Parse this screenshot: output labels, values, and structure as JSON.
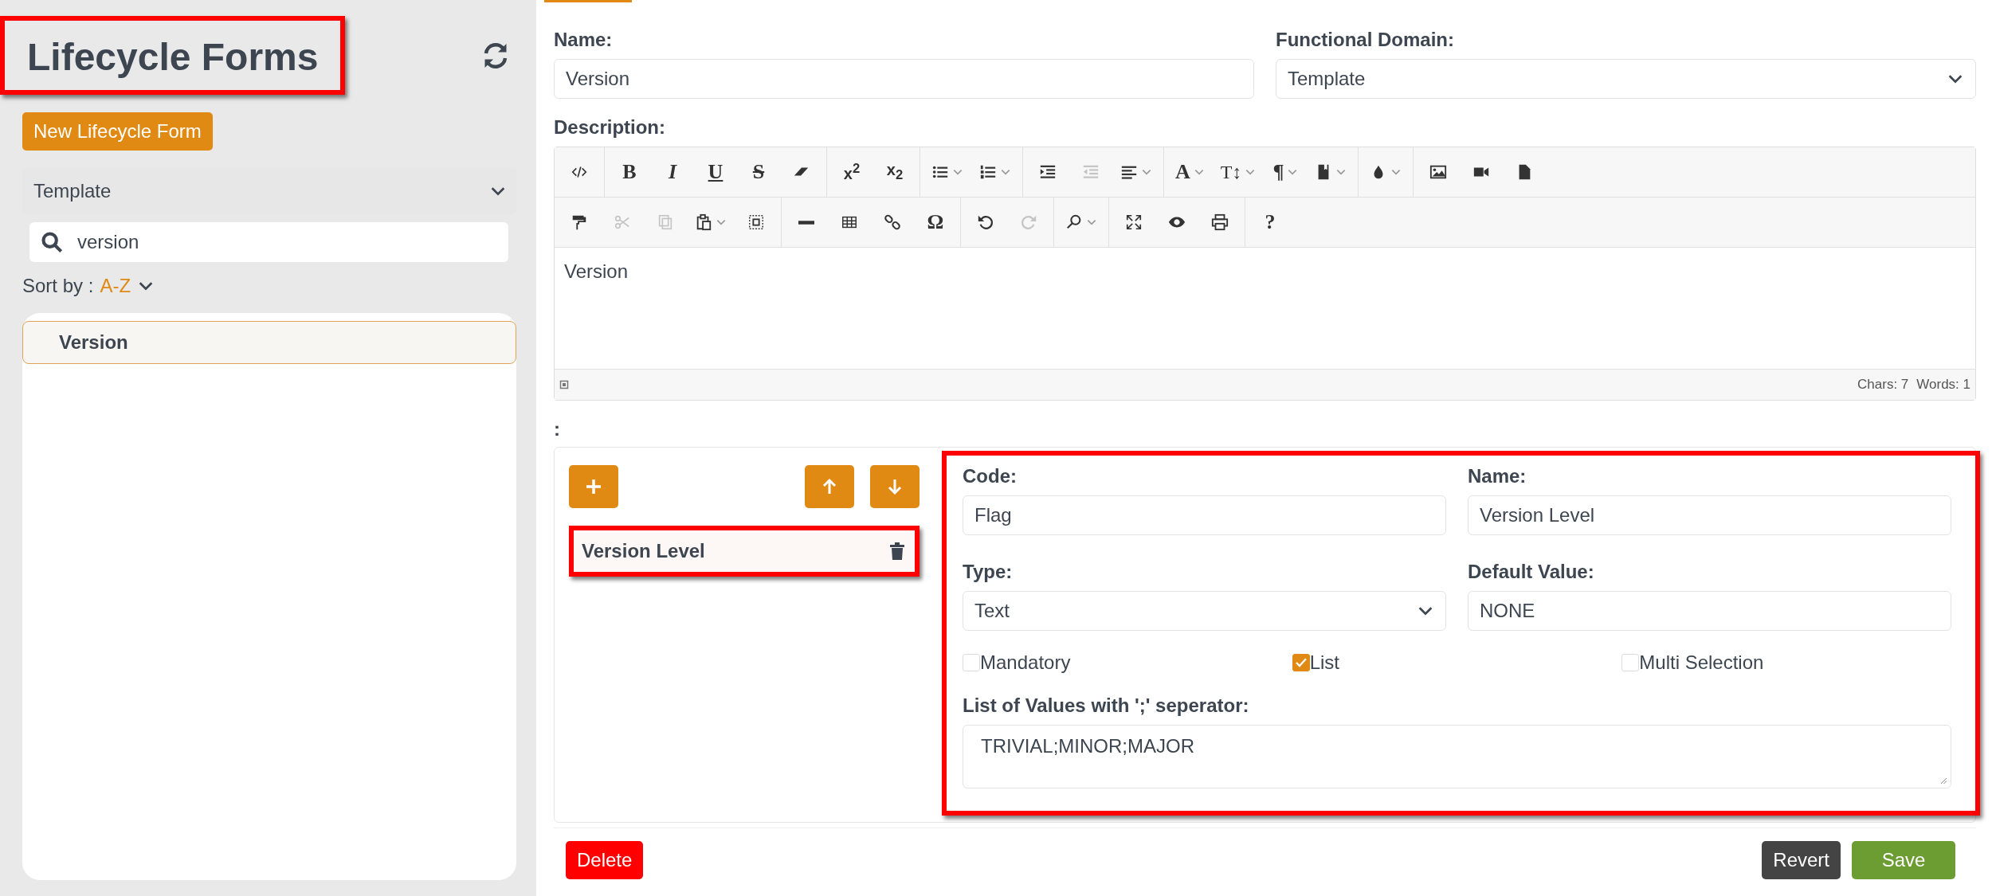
{
  "sidebar": {
    "title": "Lifecycle Forms",
    "new_button": "New Lifecycle Form",
    "domain_filter": "Template",
    "search": {
      "value": "version"
    },
    "sort": {
      "label": "Sort by :",
      "value": "A-Z"
    },
    "items": [
      {
        "label": "Version",
        "selected": true
      }
    ]
  },
  "form": {
    "name": {
      "label": "Name:",
      "value": "Version"
    },
    "domain": {
      "label": "Functional Domain:",
      "value": "Template"
    },
    "description": {
      "label": "Description:",
      "value": "Version",
      "chars": "Chars: 7",
      "words": "Words: 1"
    },
    "toolbar": [
      [
        [
          {
            "kind": "code",
            "disabled": false,
            "dropdown": false
          }
        ],
        [
          {
            "kind": "bold",
            "label": "B",
            "disabled": false,
            "dropdown": false
          },
          {
            "kind": "italic",
            "label": "I",
            "disabled": false,
            "dropdown": false
          },
          {
            "kind": "underline",
            "label": "U",
            "disabled": false,
            "dropdown": false
          },
          {
            "kind": "strike",
            "label": "S",
            "disabled": false,
            "dropdown": false
          },
          {
            "kind": "eraser",
            "disabled": false,
            "dropdown": false
          }
        ],
        [
          {
            "kind": "script",
            "label": "x$^{2}$",
            "disabled": false,
            "dropdown": false
          },
          {
            "kind": "script",
            "label": "x$_{2}$",
            "disabled": false,
            "dropdown": false
          }
        ],
        [
          {
            "kind": "bullets",
            "disabled": false,
            "dropdown": true
          },
          {
            "kind": "numbers",
            "disabled": false,
            "dropdown": true
          }
        ],
        [
          {
            "kind": "indent",
            "disabled": false,
            "dropdown": false
          },
          {
            "kind": "outdent",
            "disabled": true,
            "dropdown": false
          },
          {
            "kind": "align",
            "disabled": false,
            "dropdown": true
          }
        ],
        [
          {
            "kind": "letter",
            "label": "A",
            "disabled": false,
            "dropdown": true
          },
          {
            "kind": "size",
            "label": "T↕",
            "disabled": false,
            "dropdown": true
          },
          {
            "kind": "letter",
            "label": "¶",
            "disabled": false,
            "dropdown": true
          },
          {
            "kind": "book",
            "disabled": false,
            "dropdown": true
          }
        ],
        [
          {
            "kind": "drop",
            "disabled": false,
            "dropdown": true
          }
        ],
        [
          {
            "kind": "image",
            "disabled": false,
            "dropdown": false
          },
          {
            "kind": "video",
            "disabled": false,
            "dropdown": false
          },
          {
            "kind": "file",
            "disabled": false,
            "dropdown": false
          }
        ]
      ],
      [
        [
          {
            "kind": "paint",
            "disabled": false,
            "dropdown": false
          },
          {
            "kind": "cut",
            "disabled": true,
            "dropdown": false
          },
          {
            "kind": "copy",
            "disabled": true,
            "dropdown": false
          },
          {
            "kind": "paste",
            "disabled": false,
            "dropdown": true
          },
          {
            "kind": "select",
            "disabled": false,
            "dropdown": false
          }
        ],
        [
          {
            "kind": "hr",
            "disabled": false,
            "dropdown": false
          },
          {
            "kind": "table",
            "disabled": false,
            "dropdown": false
          },
          {
            "kind": "link",
            "disabled": false,
            "dropdown": false
          },
          {
            "kind": "letter",
            "label": "Ω",
            "disabled": false,
            "dropdown": false
          }
        ],
        [
          {
            "kind": "undo",
            "disabled": false,
            "dropdown": false
          },
          {
            "kind": "redo",
            "disabled": true,
            "dropdown": false
          }
        ],
        [
          {
            "kind": "find",
            "disabled": false,
            "dropdown": true
          }
        ],
        [
          {
            "kind": "fullscreen",
            "disabled": false,
            "dropdown": false
          },
          {
            "kind": "eye",
            "disabled": false,
            "dropdown": false
          },
          {
            "kind": "print",
            "disabled": false,
            "dropdown": false
          }
        ],
        [
          {
            "kind": "letter",
            "label": "?",
            "disabled": false,
            "dropdown": false
          }
        ]
      ]
    ],
    "section_label": ":",
    "attributes": [
      {
        "label": "Version Level",
        "selected": true
      }
    ],
    "attribute": {
      "code": {
        "label": "Code:",
        "value": "Flag"
      },
      "name": {
        "label": "Name:",
        "value": "Version Level"
      },
      "type": {
        "label": "Type:",
        "value": "Text"
      },
      "default": {
        "label": "Default Value:",
        "value": "NONE"
      },
      "options": [
        {
          "label": "Mandatory",
          "checked": false
        },
        {
          "label": "List",
          "checked": true
        },
        {
          "label": "Multi Selection",
          "checked": false
        }
      ],
      "values": {
        "label": "List of Values with ';' seperator:",
        "value": "TRIVIAL;MINOR;MAJOR"
      }
    },
    "buttons": {
      "delete": "Delete",
      "revert": "Revert",
      "save": "Save"
    }
  }
}
